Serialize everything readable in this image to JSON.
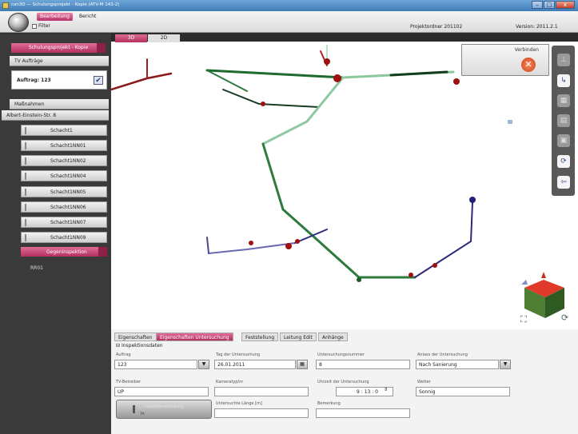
{
  "window": {
    "title": "can3D — Schulungsprojekt - Kopie (ATV-M 143-2)",
    "buttons": [
      "–",
      "□",
      "x"
    ]
  },
  "ribbon": {
    "tabs": [
      "Bearbeitung",
      "Bericht"
    ],
    "active_tab": "Bearbeitung",
    "filter_label": "Filter",
    "project_folder": "Projektordner 201102",
    "version": "Version: 2011.2.1"
  },
  "sidebar": {
    "project": "Schulungsprojekt - Kopie",
    "groups": {
      "tv_auftraege": "TV Aufträge",
      "massnahmen": "Maßnahmen",
      "street": "Albert-Einstein-Str. 8"
    },
    "auftrag": "Auftrag: 123",
    "items": [
      "Schacht1",
      "Schacht1NN01",
      "Schacht1NN02",
      "Schacht1NN04",
      "Schacht1NN05",
      "Schacht1NN06",
      "Schacht1NN07",
      "Schacht1NN09"
    ],
    "gegeninspektion": "Gegeninspektion",
    "rr01": "RR01"
  },
  "view_tabs": [
    "3D",
    "2D"
  ],
  "connect": {
    "label": "Verbinden",
    "icon": "close-icon"
  },
  "bottom": {
    "tabs": [
      "Eigenschaften",
      "Eigenschaften Untersuchung",
      "Feststellung",
      "Leitung Edit",
      "Anhänge"
    ],
    "active_tab": "Eigenschaften Untersuchung",
    "section": "Inspektionsdaten",
    "fields": {
      "auftrag": {
        "label": "Auftrag",
        "value": "123"
      },
      "tag": {
        "label": "Tag der Untersuchung",
        "value": "26.01.2011"
      },
      "untersuchungsnummer": {
        "label": "Untersuchungsnummer",
        "value": "8"
      },
      "anlass": {
        "label": "Anlass der Untersuchung",
        "value": "Nach Sanierung"
      },
      "tv_betreiber": {
        "label": "TV-Betreiber",
        "value": "UP"
      },
      "kameratyp": {
        "label": "Kameratyp/nr",
        "value": ""
      },
      "uhrzeit": {
        "label": "Uhrzeit der Untersuchung",
        "value": "9 : 13 : 0"
      },
      "wetter": {
        "label": "Wetter",
        "value": "Sonnig"
      },
      "untersuchte_laenge": {
        "label": "Untersuchte Länge [m]",
        "value": ""
      },
      "bemerkung": {
        "label": "Bemerkung",
        "value": ""
      }
    },
    "big_button": {
      "label": "Inspektionsrichtung",
      "sub": "In"
    }
  }
}
